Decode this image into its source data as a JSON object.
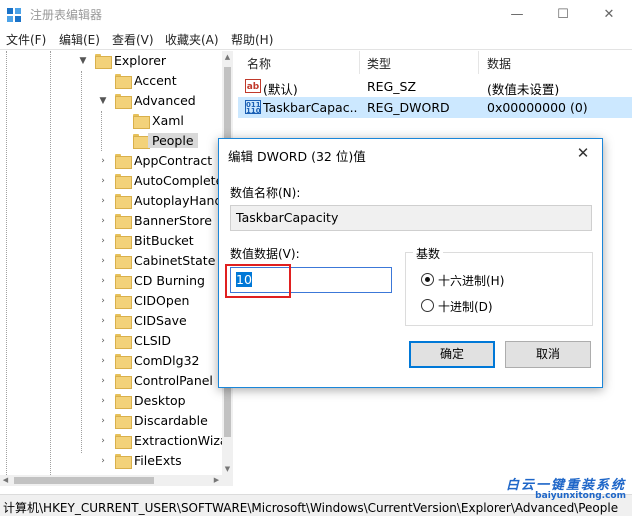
{
  "window": {
    "title": "注册表编辑器",
    "minimize_glyph": "—",
    "maximize_glyph": "☐",
    "close_glyph": "✕"
  },
  "menu": [
    "文件(F)",
    "编辑(E)",
    "查看(V)",
    "收藏夹(A)",
    "帮助(H)"
  ],
  "tree": {
    "items": [
      {
        "label": "Explorer",
        "arrow": "▼"
      },
      {
        "label": "Accent",
        "arrow": ""
      },
      {
        "label": "Advanced",
        "arrow": "▼"
      },
      {
        "label": "Xaml",
        "arrow": ""
      },
      {
        "label": "People",
        "arrow": "",
        "selected": true
      },
      {
        "label": "AppContract",
        "arrow": "›"
      },
      {
        "label": "AutoComplete",
        "arrow": "›"
      },
      {
        "label": "AutoplayHand",
        "arrow": "›"
      },
      {
        "label": "BannerStore",
        "arrow": "›"
      },
      {
        "label": "BitBucket",
        "arrow": "›"
      },
      {
        "label": "CabinetState",
        "arrow": "›"
      },
      {
        "label": "CD Burning",
        "arrow": "›"
      },
      {
        "label": "CIDOpen",
        "arrow": "›"
      },
      {
        "label": "CIDSave",
        "arrow": "›"
      },
      {
        "label": "CLSID",
        "arrow": "›"
      },
      {
        "label": "ComDlg32",
        "arrow": "›"
      },
      {
        "label": "ControlPanel",
        "arrow": "›"
      },
      {
        "label": "Desktop",
        "arrow": "›"
      },
      {
        "label": "Discardable",
        "arrow": "›"
      },
      {
        "label": "ExtractionWiza",
        "arrow": "›"
      },
      {
        "label": "FileExts",
        "arrow": "›"
      }
    ]
  },
  "list": {
    "headers": {
      "name": "名称",
      "type": "类型",
      "data": "数据"
    },
    "rows": [
      {
        "icon": "ab",
        "name": "(默认)",
        "type": "REG_SZ",
        "data": "(数值未设置)",
        "selected": false
      },
      {
        "icon": "bin",
        "name": "TaskbarCapac...",
        "type": "REG_DWORD",
        "data": "0x00000000 (0)",
        "selected": true
      }
    ]
  },
  "icons": {
    "ab": "ab",
    "bin": "011\n110"
  },
  "dialog": {
    "title": "编辑 DWORD (32 位)值",
    "close_glyph": "✕",
    "value_name_label": "数值名称(N):",
    "value_name": "TaskbarCapacity",
    "value_data_label": "数值数据(V):",
    "value_data": "10",
    "base_label": "基数",
    "base_options": [
      {
        "label": "十六进制(H)",
        "checked": true
      },
      {
        "label": "十进制(D)",
        "checked": false
      }
    ],
    "ok_label": "确定",
    "cancel_label": "取消",
    "accent_color": "#0078d7",
    "highlight_color": "#e02020"
  },
  "status": {
    "path": "计算机\\HKEY_CURRENT_USER\\SOFTWARE\\Microsoft\\Windows\\CurrentVersion\\Explorer\\Advanced\\People"
  },
  "watermark": {
    "brand": "白云一键重装系统",
    "url": "baiyunxitong.com"
  }
}
